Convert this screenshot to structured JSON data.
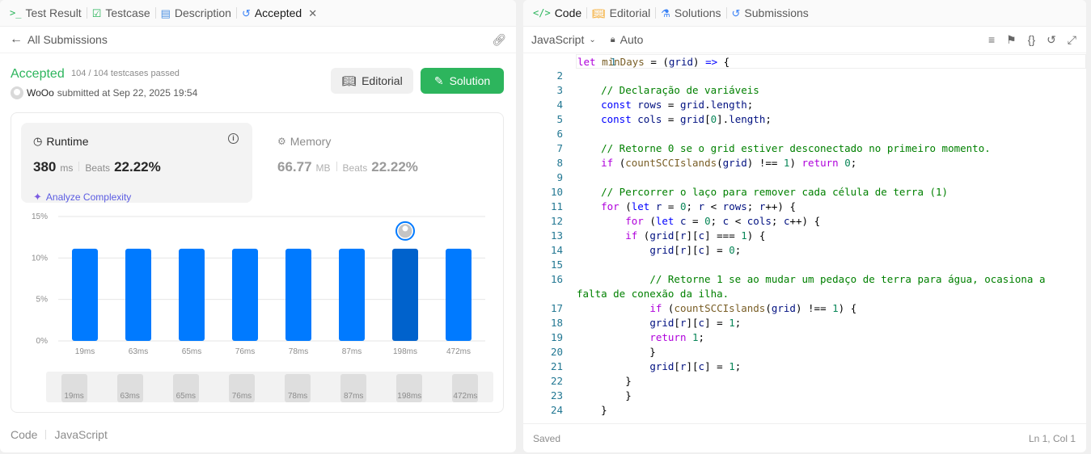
{
  "left": {
    "tabs": [
      {
        "label": "Test Result",
        "icon": "terminal-icon"
      },
      {
        "label": "Testcase",
        "icon": "check-square-icon"
      },
      {
        "label": "Description",
        "icon": "document-icon"
      },
      {
        "label": "Accepted",
        "icon": "history-icon",
        "close": "✕"
      }
    ],
    "back_label": "All Submissions",
    "status": "Accepted",
    "testcases": "104 / 104 testcases passed",
    "user": "WoOo",
    "submitted": "submitted at Sep 22, 2025 19:54",
    "editorial_btn": "Editorial",
    "solution_btn": "Solution",
    "runtime": {
      "label": "Runtime",
      "value": "380",
      "unit": "ms",
      "beats_label": "Beats",
      "beats": "22.22%",
      "analyze": "Analyze Complexity"
    },
    "memory": {
      "label": "Memory",
      "value": "66.77",
      "unit": "MB",
      "beats_label": "Beats",
      "beats": "22.22%"
    },
    "footer": {
      "code": "Code",
      "lang": "JavaScript"
    }
  },
  "chart_data": {
    "type": "bar",
    "categories": [
      "19ms",
      "63ms",
      "65ms",
      "76ms",
      "78ms",
      "87ms",
      "198ms",
      "472ms"
    ],
    "values": [
      11.11,
      11.11,
      11.11,
      11.11,
      11.11,
      11.11,
      11.11,
      11.11
    ],
    "highlight_index": 6,
    "yticks": [
      "0%",
      "5%",
      "10%",
      "15%"
    ],
    "ylim": [
      0,
      15
    ],
    "colors": {
      "bar": "#007aff",
      "highlight": "#0062cc"
    }
  },
  "right": {
    "tabs": [
      {
        "label": "Code",
        "icon": "code-icon"
      },
      {
        "label": "Editorial",
        "icon": "book-icon"
      },
      {
        "label": "Solutions",
        "icon": "flask-icon"
      },
      {
        "label": "Submissions",
        "icon": "history-icon"
      }
    ],
    "language": "JavaScript",
    "mode": "Auto",
    "status": "Saved",
    "cursor": "Ln 1, Col 1"
  }
}
